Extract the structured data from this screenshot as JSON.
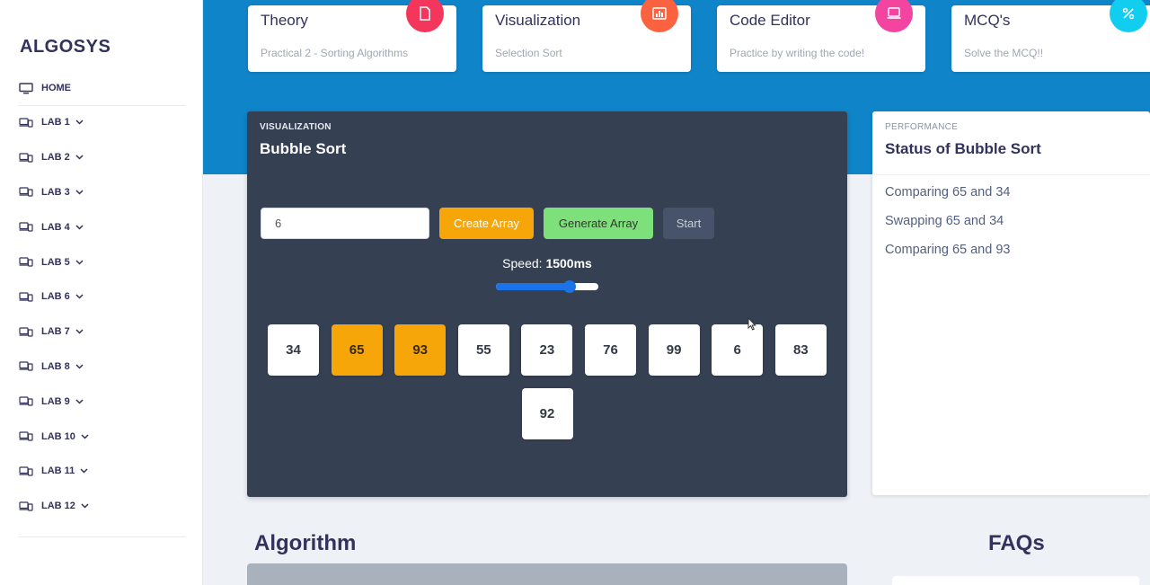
{
  "sidebar": {
    "brand": "ALGOSYS",
    "home": "HOME",
    "labs": [
      "LAB 1",
      "LAB 2",
      "LAB 3",
      "LAB 4",
      "LAB 5",
      "LAB 6",
      "LAB 7",
      "LAB 8",
      "LAB 9",
      "LAB 10",
      "LAB 11",
      "LAB 12"
    ]
  },
  "cards": [
    {
      "title": "Theory",
      "subtitle": "Practical 2 - Sorting Algorithms",
      "icon": "document-icon",
      "color": "#f5365c"
    },
    {
      "title": "Visualization",
      "subtitle": "Selection Sort",
      "icon": "chart-bar-icon",
      "color": "#fb6340"
    },
    {
      "title": "Code Editor",
      "subtitle": "Practice by writing the code!",
      "icon": "laptop-code-icon",
      "color": "#f3449f"
    },
    {
      "title": "MCQ's",
      "subtitle": "Solve the MCQ!!",
      "icon": "percent-icon",
      "color": "#11cdef"
    }
  ],
  "viz": {
    "eyebrow": "VISUALIZATION",
    "title": "Bubble Sort",
    "input_value": "6",
    "create_label": "Create Array",
    "generate_label": "Generate Array",
    "start_label": "Start",
    "speed_label": "Speed:",
    "speed_value": "1500ms",
    "speed_fraction": 0.72,
    "array": [
      {
        "value": "34",
        "highlight": false
      },
      {
        "value": "65",
        "highlight": true
      },
      {
        "value": "93",
        "highlight": true
      },
      {
        "value": "55",
        "highlight": false
      },
      {
        "value": "23",
        "highlight": false
      },
      {
        "value": "76",
        "highlight": false
      },
      {
        "value": "99",
        "highlight": false
      },
      {
        "value": "6",
        "highlight": false
      },
      {
        "value": "83",
        "highlight": false
      },
      {
        "value": "92",
        "highlight": false
      }
    ]
  },
  "perf": {
    "eyebrow": "PERFORMANCE",
    "title": "Status of Bubble Sort",
    "lines": [
      "Comparing 65 and 34",
      "Swapping 65 and 34",
      "Comparing 65 and 93"
    ]
  },
  "bottom": {
    "algorithm_heading": "Algorithm",
    "faq_heading": "FAQs"
  },
  "colors": {
    "band": "#0f84c9",
    "panel": "#354052",
    "highlight": "#f6a609",
    "generate": "#7ee07a",
    "accent": "#1a73e8"
  }
}
